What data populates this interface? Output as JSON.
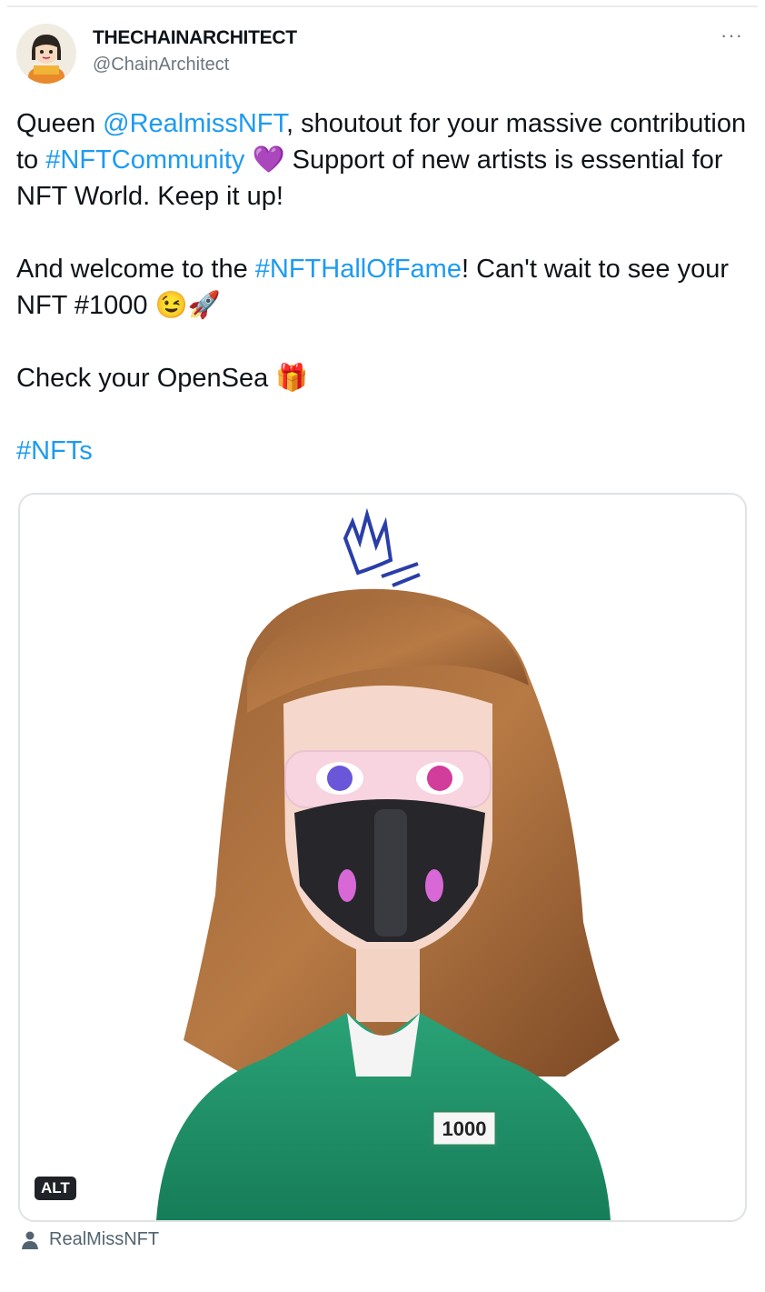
{
  "tweet": {
    "display_name": "THECHAINARCHITECT",
    "handle": "@ChainArchitect",
    "more_icon": "more-dots-icon",
    "text": {
      "p1_a": "Queen ",
      "p1_mention": "@RealmissNFT",
      "p1_b": ", shoutout for your massive contribution to ",
      "p1_hashtag": "#NFTCommunity",
      "p1_c": " 💜 Support of new artists is essential for NFT World. Keep it up!",
      "p2_a": "And welcome to the ",
      "p2_hashtag": "#NFTHallOfFame",
      "p2_b": "! Can't wait to see your NFT #1000 😉🚀",
      "p3": "Check your OpenSea 🎁",
      "p4_hashtag": "#NFTs"
    },
    "media": {
      "alt_badge": "ALT",
      "jersey_number": "1000"
    },
    "tagged_user": "RealMissNFT",
    "tagged_icon": "person-icon",
    "colors": {
      "link": "#1d9bf0",
      "handle": "#6b7680"
    }
  }
}
